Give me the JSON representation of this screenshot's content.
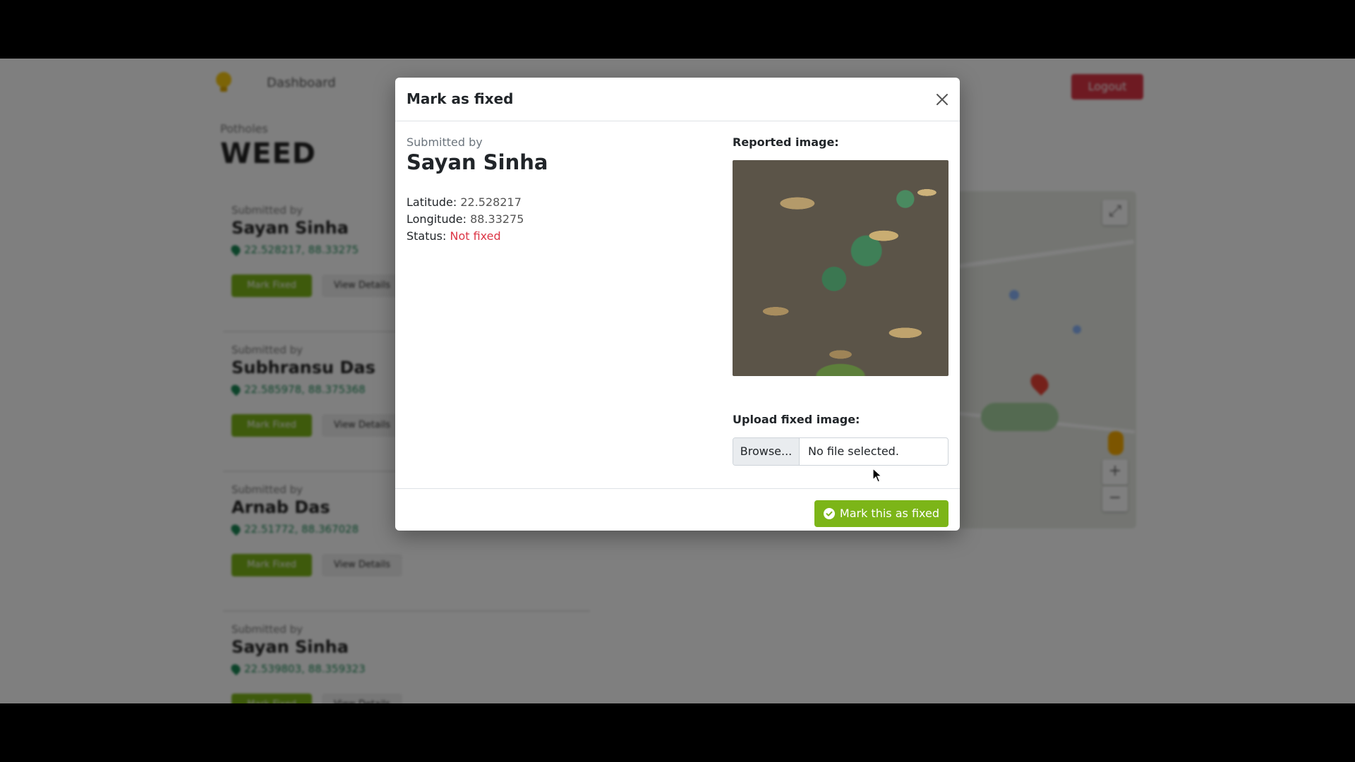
{
  "background": {
    "nav": {
      "link": "Dashboard",
      "logout": "Logout"
    },
    "category_label": "Potholes",
    "category_title": "WEED",
    "cards": [
      {
        "submitted_label": "Submitted by",
        "name": "Sayan Sinha",
        "coords": "22.528217, 88.33275",
        "fix_label": "Mark Fixed",
        "details_label": "View Details"
      },
      {
        "submitted_label": "Submitted by",
        "name": "Subhransu Das",
        "coords": "22.585978, 88.375368",
        "fix_label": "Mark Fixed",
        "details_label": "View Details"
      },
      {
        "submitted_label": "Submitted by",
        "name": "Arnab Das",
        "coords": "22.51772, 88.367028",
        "fix_label": "Mark Fixed",
        "details_label": "View Details"
      },
      {
        "submitted_label": "Submitted by",
        "name": "Sayan Sinha",
        "coords": "22.539803, 88.359323",
        "fix_label": "Mark Fixed",
        "details_label": "View Details"
      }
    ]
  },
  "modal": {
    "title": "Mark as fixed",
    "submitted_label": "Submitted by",
    "submitter_name": "Sayan Sinha",
    "latitude_label": "Latitude:",
    "latitude": "22.528217",
    "longitude_label": "Longitude:",
    "longitude": "88.33275",
    "status_label": "Status:",
    "status": "Not fixed",
    "reported_image_label": "Reported image:",
    "upload_label": "Upload fixed image:",
    "browse_label": "Browse...",
    "file_placeholder": "No file selected.",
    "submit_label": "Mark this as fixed"
  },
  "colors": {
    "accent_green": "#7cb518",
    "danger_red": "#dc3545",
    "coord_green": "#198754"
  },
  "icons": [
    "bulb-logo-icon",
    "close-icon",
    "check-circle-icon",
    "map-pin-icon",
    "cursor-icon"
  ]
}
